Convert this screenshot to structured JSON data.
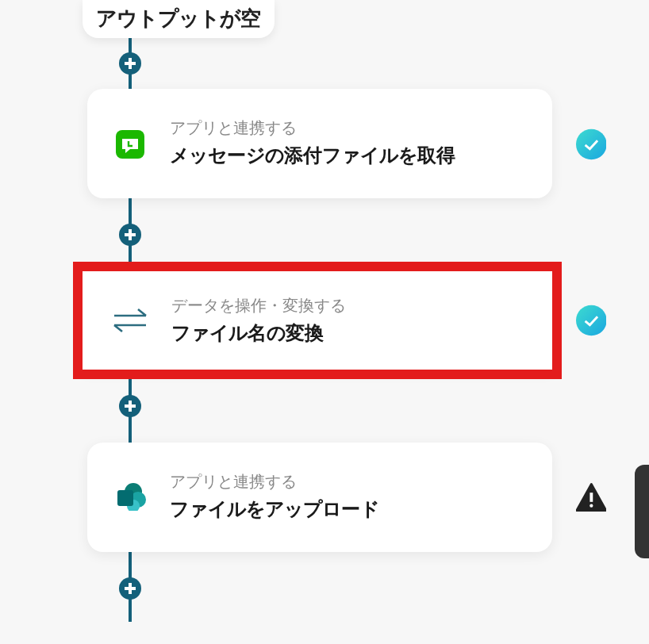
{
  "start_node": {
    "label": "アウトプットが空"
  },
  "steps": [
    {
      "category": "アプリと連携する",
      "title": "メッセージの添付ファイルを取得",
      "complete": true,
      "highlighted": false
    },
    {
      "category": "データを操作・変換する",
      "title": "ファイル名の変換",
      "complete": true,
      "highlighted": true
    },
    {
      "category": "アプリと連携する",
      "title": "ファイルをアップロード",
      "complete": false,
      "highlighted": false
    }
  ]
}
